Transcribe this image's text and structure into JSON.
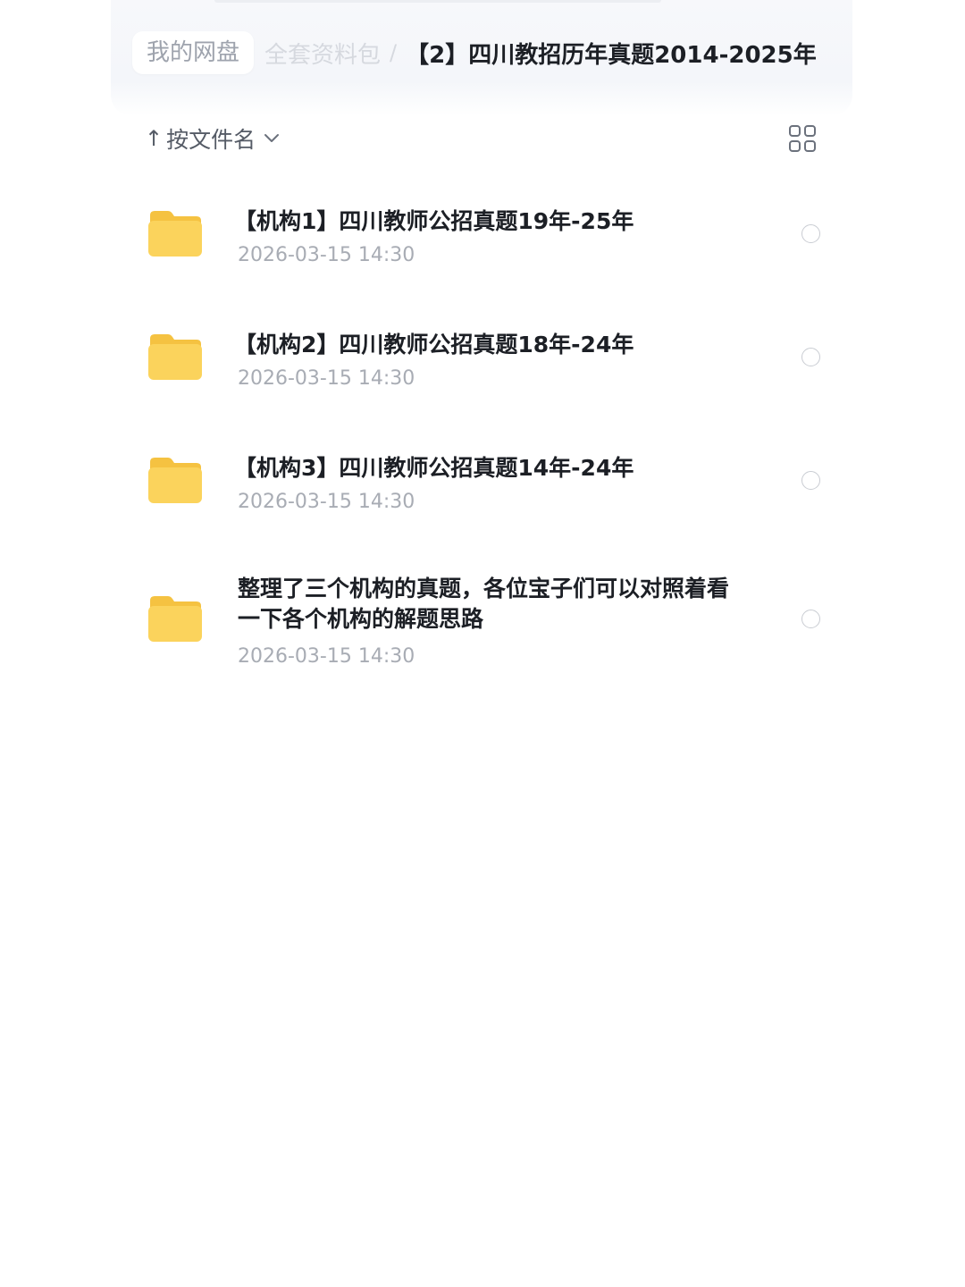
{
  "breadcrumb": {
    "home": "我的网盘",
    "middle": "全套资料包",
    "separator": "/",
    "current": "【2】四川教招历年真题2014-2025年"
  },
  "sort": {
    "arrow": "↑",
    "label": "按文件名"
  },
  "icons": {
    "sort_arrow": "arrow-up-icon",
    "sort_chevron": "chevron-down-icon",
    "view_toggle": "grid-view-icon",
    "folder": "folder-icon",
    "select": "radio-circle-icon"
  },
  "colors": {
    "folder": "#FBD35C",
    "folder_tab": "#F5C241",
    "text_primary": "#1C1F25",
    "text_secondary": "#A8ACB4"
  },
  "files": [
    {
      "name": "【机构1】四川教师公招真题19年-25年",
      "date": "2026-03-15 14:30"
    },
    {
      "name": "【机构2】四川教师公招真题18年-24年",
      "date": "2026-03-15 14:30"
    },
    {
      "name": "【机构3】四川教师公招真题14年-24年",
      "date": "2026-03-15 14:30"
    },
    {
      "name": "整理了三个机构的真题，各位宝子们可以对照着看一下各个机构的解题思路",
      "date": "2026-03-15 14:30"
    }
  ]
}
